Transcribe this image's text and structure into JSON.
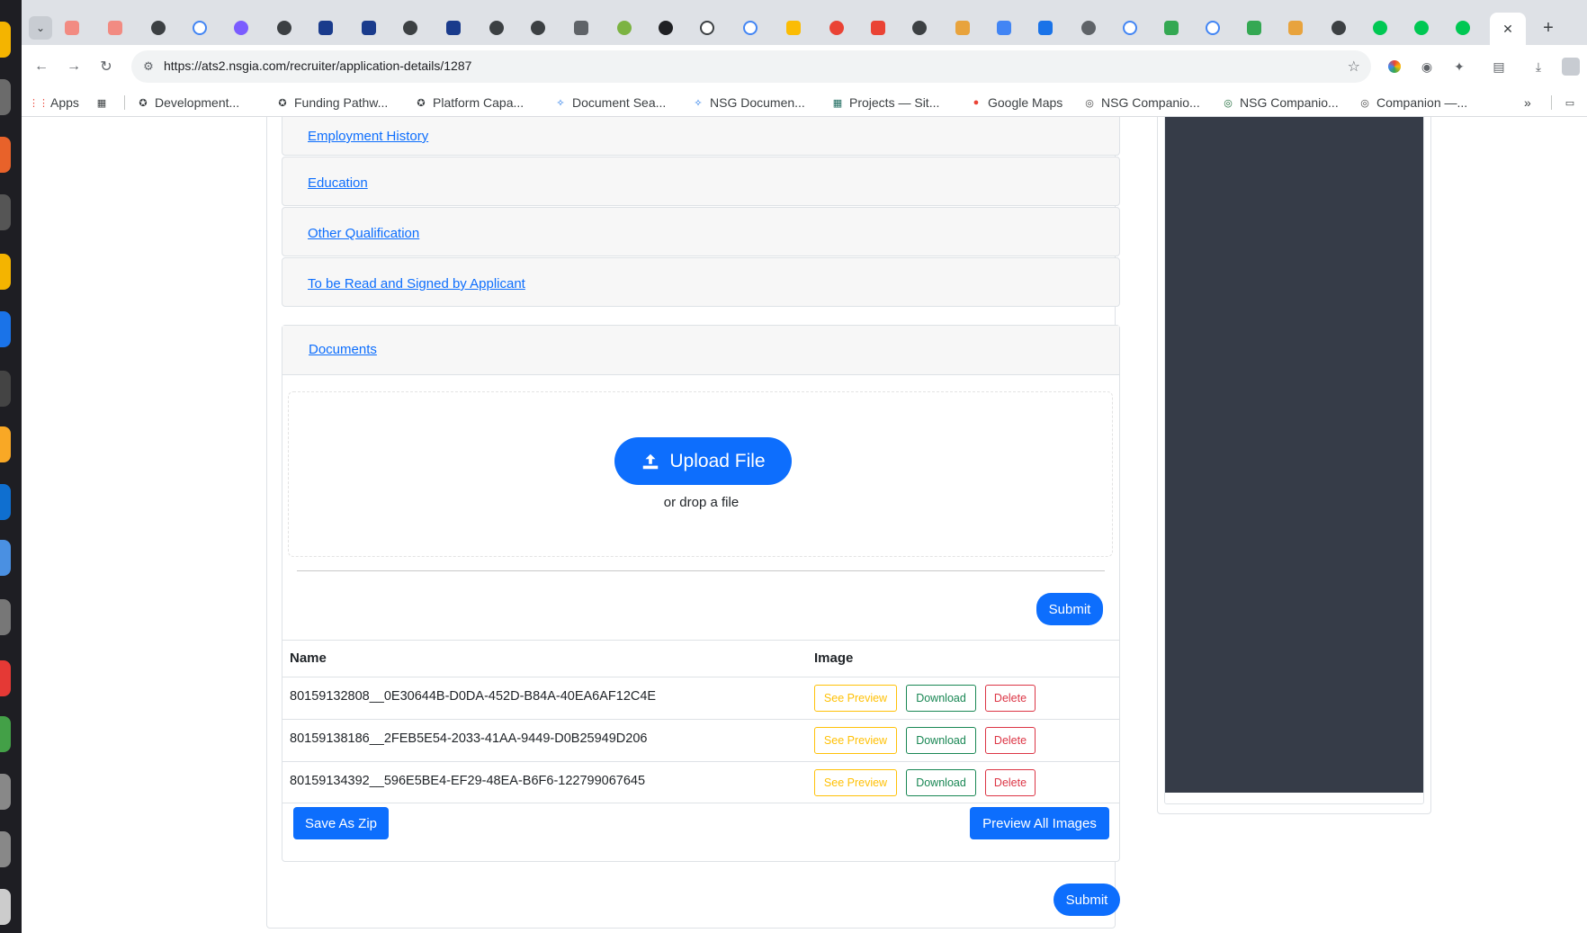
{
  "browser": {
    "url": "https://ats2.nsgia.com/recruiter/application-details/1287",
    "active_tab_close": "✕",
    "new_tab": "+",
    "bookmarks": [
      {
        "label": "Apps",
        "icon": "apps-grid-icon"
      },
      {
        "label": "Development...",
        "icon": "star-circle-icon"
      },
      {
        "label": "Funding Pathw...",
        "icon": "star-circle-icon"
      },
      {
        "label": "Platform Capa...",
        "icon": "star-circle-icon"
      },
      {
        "label": "Document Sea...",
        "icon": "sparkle-icon"
      },
      {
        "label": "NSG Documen...",
        "icon": "sparkle-icon"
      },
      {
        "label": "Projects — Sit...",
        "icon": "grid-icon"
      },
      {
        "label": "Google Maps",
        "icon": "map-pin-icon"
      },
      {
        "label": "NSG Companio...",
        "icon": "chatgpt-icon"
      },
      {
        "label": "NSG Companio...",
        "icon": "chatgpt-icon"
      },
      {
        "label": "Companion —...",
        "icon": "chatgpt-icon"
      }
    ],
    "bookmarks_overflow": "»"
  },
  "accordion": {
    "employment_history": "Employment History",
    "education": "Education",
    "other_qualification": "Other Qualification",
    "read_and_sign": "To be Read and Signed by Applicant",
    "documents": "Documents"
  },
  "upload": {
    "button_label": "Upload File",
    "hint": "or drop a file"
  },
  "documents": {
    "submit_label": "Submit",
    "columns": {
      "name": "Name",
      "image": "Image"
    },
    "rows": [
      {
        "name": "80159132808__0E30644B-D0DA-452D-B84A-40EA6AF12C4E"
      },
      {
        "name": "80159138186__2FEB5E54-2033-41AA-9449-D0B25949D206"
      },
      {
        "name": "80159134392__596E5BE4-EF29-48EA-B6F6-122799067645"
      }
    ],
    "row_actions": {
      "preview": "See Preview",
      "download": "Download",
      "delete": "Delete"
    },
    "save_zip_label": "Save As Zip",
    "preview_all_label": "Preview All Images"
  },
  "page_submit_label": "Submit",
  "colors": {
    "primary": "#0d6efd",
    "warning": "#ffc107",
    "success": "#198754",
    "danger": "#dc3545",
    "side_panel": "#363c48"
  }
}
